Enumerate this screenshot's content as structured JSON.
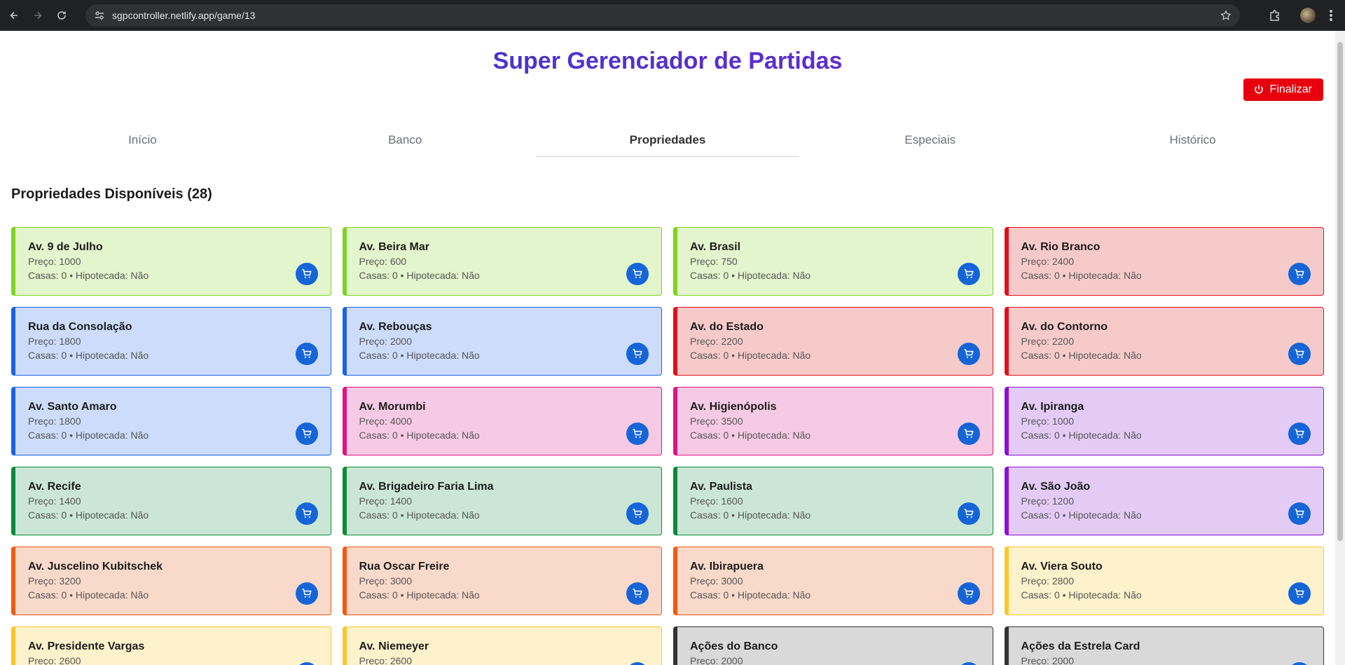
{
  "browser": {
    "url": "sgpcontroller.netlify.app/game/13"
  },
  "header": {
    "title": "Super Gerenciador de Partidas",
    "finish_label": "Finalizar"
  },
  "tabs": [
    {
      "label": "Início",
      "active": false
    },
    {
      "label": "Banco",
      "active": false
    },
    {
      "label": "Propriedades",
      "active": true
    },
    {
      "label": "Especiais",
      "active": false
    },
    {
      "label": "Histórico",
      "active": false
    }
  ],
  "section_title": "Propriedades Disponíveis (28)",
  "properties": [
    {
      "name": "Av. 9 de Julho",
      "price": "Preço: 1000",
      "status": "Casas: 0 • Hipotecada: Não",
      "color": "green"
    },
    {
      "name": "Av. Beira Mar",
      "price": "Preço: 600",
      "status": "Casas: 0 • Hipotecada: Não",
      "color": "green"
    },
    {
      "name": "Av. Brasil",
      "price": "Preço: 750",
      "status": "Casas: 0 • Hipotecada: Não",
      "color": "green"
    },
    {
      "name": "Av. Rio Branco",
      "price": "Preço: 2400",
      "status": "Casas: 0 • Hipotecada: Não",
      "color": "red"
    },
    {
      "name": "Rua da Consolação",
      "price": "Preço: 1800",
      "status": "Casas: 0 • Hipotecada: Não",
      "color": "blue"
    },
    {
      "name": "Av. Rebouças",
      "price": "Preço: 2000",
      "status": "Casas: 0 • Hipotecada: Não",
      "color": "blue"
    },
    {
      "name": "Av. do Estado",
      "price": "Preço: 2200",
      "status": "Casas: 0 • Hipotecada: Não",
      "color": "red"
    },
    {
      "name": "Av. do Contorno",
      "price": "Preço: 2200",
      "status": "Casas: 0 • Hipotecada: Não",
      "color": "red"
    },
    {
      "name": "Av. Santo Amaro",
      "price": "Preço: 1800",
      "status": "Casas: 0 • Hipotecada: Não",
      "color": "blue"
    },
    {
      "name": "Av. Morumbi",
      "price": "Preço: 4000",
      "status": "Casas: 0 • Hipotecada: Não",
      "color": "pink"
    },
    {
      "name": "Av. Higienópolis",
      "price": "Preço: 3500",
      "status": "Casas: 0 • Hipotecada: Não",
      "color": "pink"
    },
    {
      "name": "Av. Ipiranga",
      "price": "Preço: 1000",
      "status": "Casas: 0 • Hipotecada: Não",
      "color": "purple"
    },
    {
      "name": "Av. Recife",
      "price": "Preço: 1400",
      "status": "Casas: 0 • Hipotecada: Não",
      "color": "dgreen"
    },
    {
      "name": "Av. Brigadeiro Faria Lima",
      "price": "Preço: 1400",
      "status": "Casas: 0 • Hipotecada: Não",
      "color": "dgreen"
    },
    {
      "name": "Av. Paulista",
      "price": "Preço: 1600",
      "status": "Casas: 0 • Hipotecada: Não",
      "color": "dgreen"
    },
    {
      "name": "Av. São João",
      "price": "Preço: 1200",
      "status": "Casas: 0 • Hipotecada: Não",
      "color": "purple"
    },
    {
      "name": "Av. Juscelino Kubitschek",
      "price": "Preço: 3200",
      "status": "Casas: 0 • Hipotecada: Não",
      "color": "orange"
    },
    {
      "name": "Rua Oscar Freire",
      "price": "Preço: 3000",
      "status": "Casas: 0 • Hipotecada: Não",
      "color": "orange"
    },
    {
      "name": "Av. Ibirapuera",
      "price": "Preço: 3000",
      "status": "Casas: 0 • Hipotecada: Não",
      "color": "orange"
    },
    {
      "name": "Av. Viera Souto",
      "price": "Preço: 2800",
      "status": "Casas: 0 • Hipotecada: Não",
      "color": "yellow"
    },
    {
      "name": "Av. Presidente Vargas",
      "price": "Preço: 2600",
      "status": "",
      "color": "yellow"
    },
    {
      "name": "Av. Niemeyer",
      "price": "Preço: 2600",
      "status": "",
      "color": "yellow"
    },
    {
      "name": "Ações do Banco",
      "price": "Preço: 2000",
      "status": "",
      "color": "gray"
    },
    {
      "name": "Ações da Estrela Card",
      "price": "Preço: 2000",
      "status": "",
      "color": "gray"
    }
  ],
  "icons": {
    "buy": "shopping-cart-icon",
    "finish": "power-icon"
  },
  "colors": {
    "accent_blue": "#1565d8",
    "finish_red": "#e7000b",
    "title_gradient_start": "#2f3fc1",
    "title_gradient_end": "#7a23d6"
  }
}
